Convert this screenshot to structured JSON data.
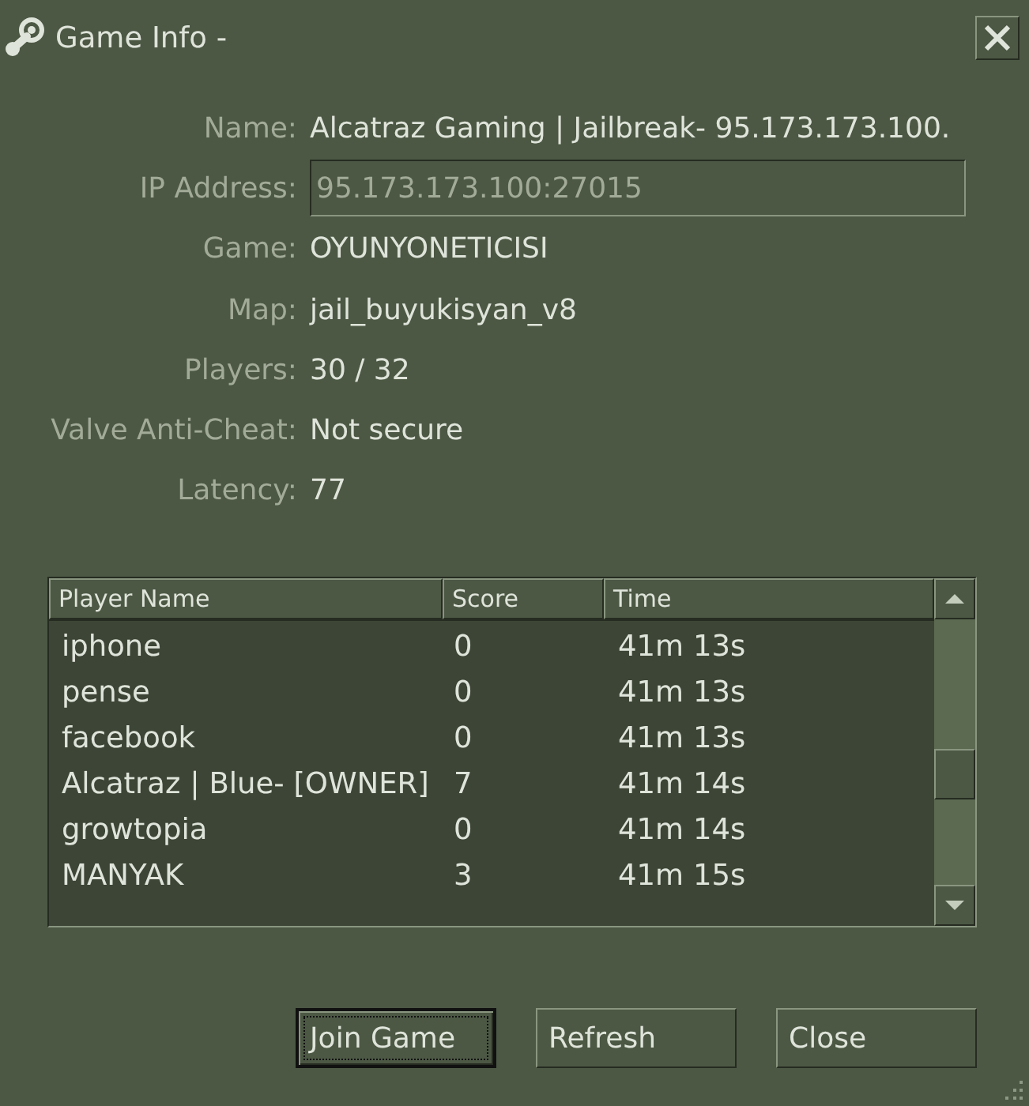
{
  "window": {
    "title": "Game Info -"
  },
  "fields": [
    {
      "kind": "text",
      "label": "Name:",
      "value": "Alcatraz Gaming | Jailbreak- 95.173.173.100."
    },
    {
      "kind": "input",
      "label": "IP Address:",
      "value": "95.173.173.100:27015"
    },
    {
      "kind": "text",
      "label": "Game:",
      "value": "OYUNYONETICISI"
    },
    {
      "kind": "text",
      "label": "Map:",
      "value": "jail_buyukisyan_v8"
    },
    {
      "kind": "text",
      "label": "Players:",
      "value": "30 / 32"
    },
    {
      "kind": "text",
      "label": "Valve Anti-Cheat:",
      "value": "Not secure"
    },
    {
      "kind": "text",
      "label": "Latency:",
      "value": "77"
    }
  ],
  "players_table": {
    "columns": [
      "Player Name",
      "Score",
      "Time"
    ],
    "rows": [
      {
        "name": "iphone",
        "score": "0",
        "time": "41m 13s"
      },
      {
        "name": "pense",
        "score": "0",
        "time": "41m 13s"
      },
      {
        "name": "facebook",
        "score": "0",
        "time": "41m 13s"
      },
      {
        "name": "Alcatraz | Blue- [OWNER]",
        "score": "7",
        "time": "41m 14s"
      },
      {
        "name": "growtopia",
        "score": "0",
        "time": "41m 14s"
      },
      {
        "name": "MANYAK",
        "score": "3",
        "time": "41m 15s"
      }
    ]
  },
  "buttons": [
    {
      "label": "Join Game",
      "default": true
    },
    {
      "label": "Refresh",
      "default": false
    },
    {
      "label": "Close",
      "default": false
    }
  ]
}
